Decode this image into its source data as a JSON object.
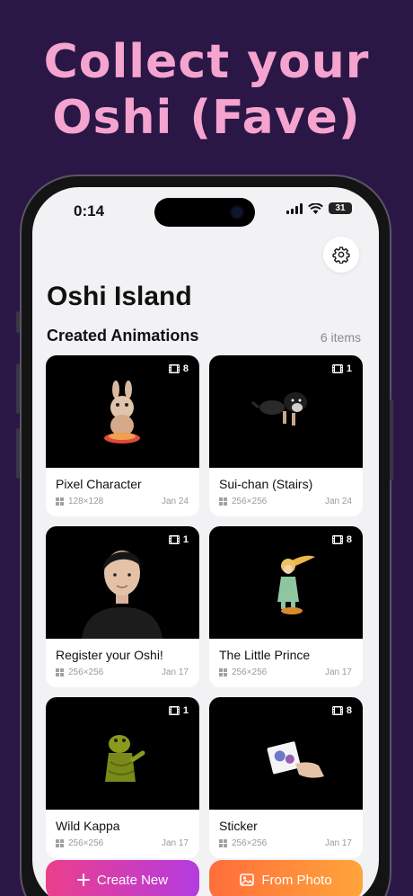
{
  "headline": {
    "line1": "Collect your",
    "line2": "Oshi (Fave)"
  },
  "status_bar": {
    "time": "0:14",
    "battery": "31"
  },
  "app": {
    "title": "Oshi Island"
  },
  "section": {
    "title": "Created Animations",
    "count": "6 items"
  },
  "cards": [
    {
      "title": "Pixel Character",
      "resolution": "128×128",
      "date": "Jan 24",
      "frames": "8"
    },
    {
      "title": "Sui-chan (Stairs)",
      "resolution": "256×256",
      "date": "Jan 24",
      "frames": "1"
    },
    {
      "title": "Register your Oshi!",
      "resolution": "256×256",
      "date": "Jan 17",
      "frames": "1"
    },
    {
      "title": "The Little Prince",
      "resolution": "256×256",
      "date": "Jan 17",
      "frames": "8"
    },
    {
      "title": "Wild Kappa",
      "resolution": "256×256",
      "date": "Jan 17",
      "frames": "1"
    },
    {
      "title": "Sticker",
      "resolution": "256×256",
      "date": "Jan 17",
      "frames": "8"
    }
  ],
  "actions": {
    "create_new": "Create New",
    "from_photo": "From Photo"
  },
  "icons": {
    "settings": "gear-icon",
    "frames": "film-icon",
    "resolution": "grid-icon",
    "create": "plus-icon",
    "photo": "image-icon"
  },
  "colors": {
    "background": "#2a1745",
    "headline": "#f5a3cf",
    "create_gradient": [
      "#ec3e8b",
      "#b43ce0"
    ],
    "photo_gradient": [
      "#ff6e3a",
      "#ffa53a"
    ]
  }
}
